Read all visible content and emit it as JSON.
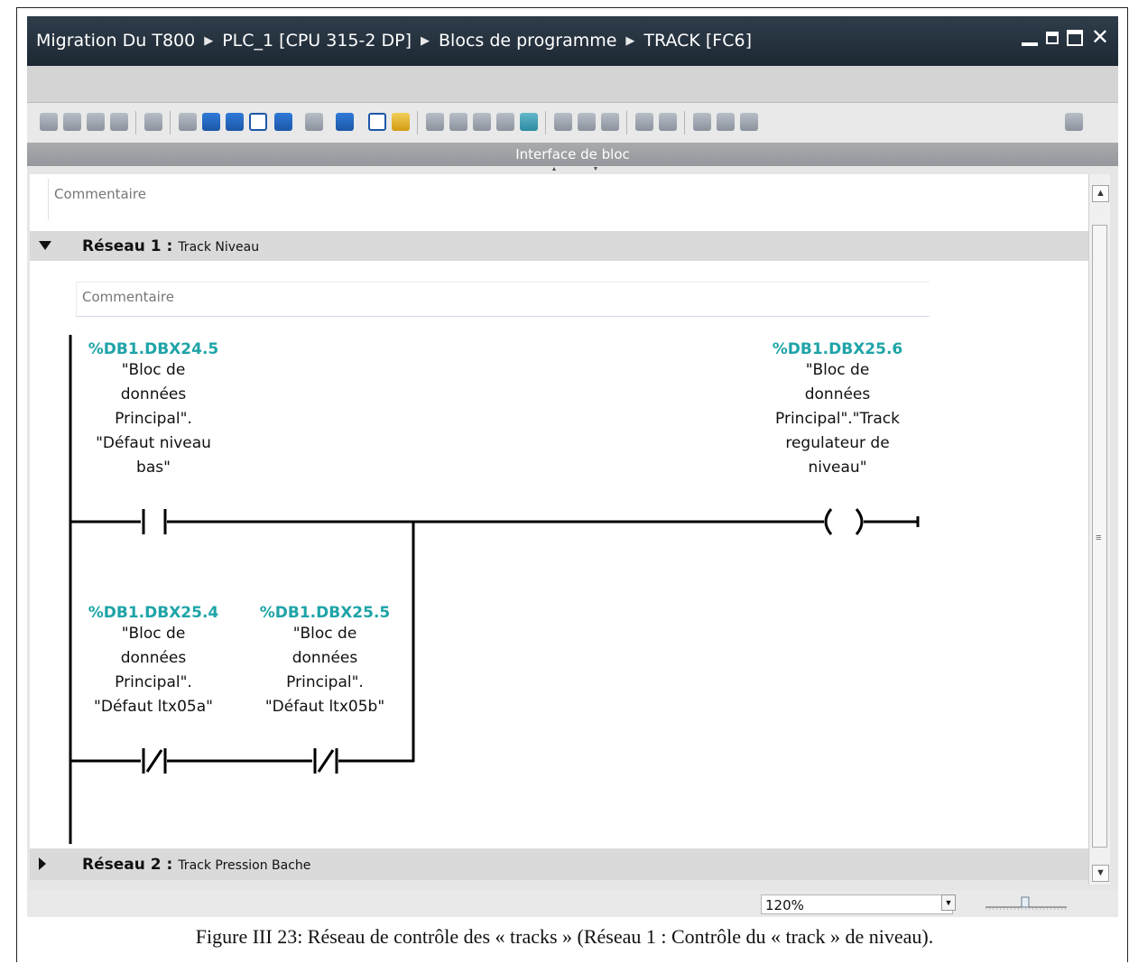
{
  "titlebar": {
    "crumbs": [
      "Migration Du T800",
      "PLC_1 [CPU 315-2 DP]",
      "Blocs de programme",
      "TRACK [FC6]"
    ]
  },
  "interface_bar": {
    "title": "Interface de bloc"
  },
  "block_comment": "Commentaire",
  "network1": {
    "label": "Réseau 1 :",
    "name": "Track Niveau",
    "comment": "Commentaire",
    "contact_no": {
      "address": "%DB1.DBX24.5",
      "symbol": "\"Bloc de\ndonnées\nPrincipal\".\n\"Défaut niveau\nbas\""
    },
    "coil": {
      "address": "%DB1.DBX25.6",
      "symbol": "\"Bloc de\ndonnées\nPrincipal\".\"Track\nregulateur de\nniveau\""
    },
    "contact_nc_a": {
      "address": "%DB1.DBX25.4",
      "symbol": "\"Bloc de\ndonnées\nPrincipal\".\n\"Défaut ltx05a\""
    },
    "contact_nc_b": {
      "address": "%DB1.DBX25.5",
      "symbol": "\"Bloc de\ndonnées\nPrincipal\".\n\"Défaut ltx05b\""
    }
  },
  "network2": {
    "label": "Réseau 2 :",
    "name": "Track Pression Bache"
  },
  "zoom": {
    "value": "120%"
  },
  "caption": "Figure III 23: Réseau de contrôle des « tracks » (Réseau 1 : Contrôle du « track » de niveau)."
}
